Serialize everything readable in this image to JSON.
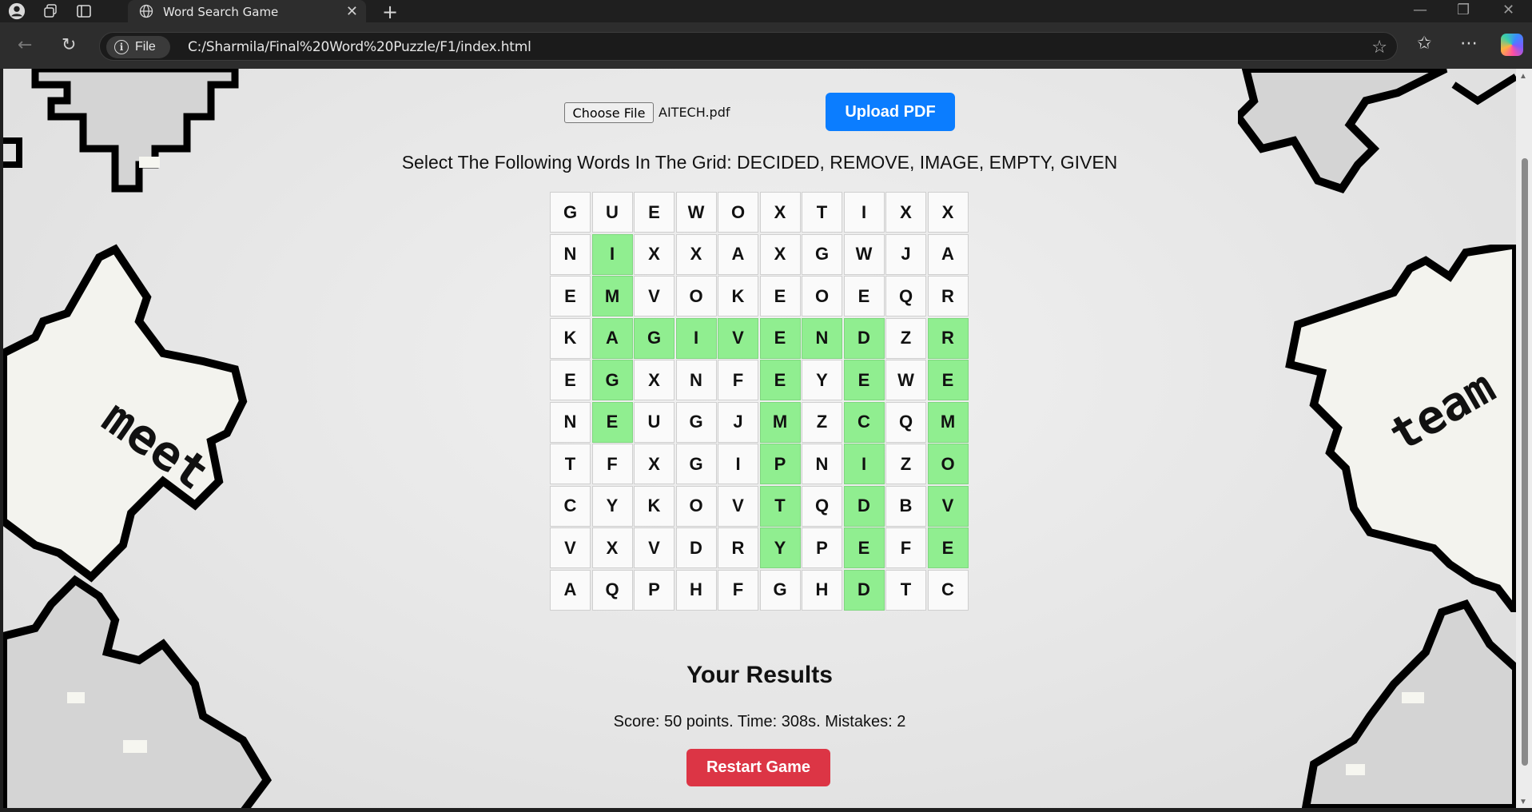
{
  "browser": {
    "tab_title": "Word Search Game",
    "scheme_label": "File",
    "url": "C:/Sharmila/Final%20Word%20Puzzle/F1/index.html"
  },
  "icons": {
    "profile": "profile-icon",
    "workspaces": "workspaces-icon",
    "tab_actions": "tab-actions-icon",
    "globe": "globe-icon",
    "close": "close-icon",
    "new_tab": "plus-icon",
    "back": "back-arrow-icon",
    "reload": "reload-icon",
    "info": "info-icon",
    "favorite": "star-icon",
    "favorites": "favorites-icon",
    "menu": "more-icon",
    "copilot": "copilot-icon"
  },
  "uploader": {
    "choose_label": "Choose File",
    "file_name": "AITECH.pdf",
    "upload_label": "Upload PDF"
  },
  "instruction": "Select The Following Words In The Grid: DECIDED, REMOVE, IMAGE, EMPTY, GIVEN",
  "grid": {
    "rows": [
      [
        "G",
        "U",
        "E",
        "W",
        "O",
        "X",
        "T",
        "I",
        "X",
        "X"
      ],
      [
        "N",
        "I",
        "X",
        "X",
        "A",
        "X",
        "G",
        "W",
        "J",
        "A"
      ],
      [
        "E",
        "M",
        "V",
        "O",
        "K",
        "E",
        "O",
        "E",
        "Q",
        "R"
      ],
      [
        "K",
        "A",
        "G",
        "I",
        "V",
        "E",
        "N",
        "D",
        "Z",
        "R"
      ],
      [
        "E",
        "G",
        "X",
        "N",
        "F",
        "E",
        "Y",
        "E",
        "W",
        "E"
      ],
      [
        "N",
        "E",
        "U",
        "G",
        "J",
        "M",
        "Z",
        "C",
        "Q",
        "M"
      ],
      [
        "T",
        "F",
        "X",
        "G",
        "I",
        "P",
        "N",
        "I",
        "Z",
        "O"
      ],
      [
        "C",
        "Y",
        "K",
        "O",
        "V",
        "T",
        "Q",
        "D",
        "B",
        "V"
      ],
      [
        "V",
        "X",
        "V",
        "D",
        "R",
        "Y",
        "P",
        "E",
        "F",
        "E"
      ],
      [
        "A",
        "Q",
        "P",
        "H",
        "F",
        "G",
        "H",
        "D",
        "T",
        "C"
      ]
    ],
    "found": [
      [
        1,
        1
      ],
      [
        2,
        1
      ],
      [
        3,
        1
      ],
      [
        4,
        1
      ],
      [
        5,
        1
      ],
      [
        3,
        2
      ],
      [
        3,
        3
      ],
      [
        3,
        4
      ],
      [
        3,
        5
      ],
      [
        3,
        6
      ],
      [
        3,
        7
      ],
      [
        4,
        7
      ],
      [
        5,
        7
      ],
      [
        6,
        7
      ],
      [
        7,
        7
      ],
      [
        8,
        7
      ],
      [
        9,
        7
      ],
      [
        3,
        9
      ],
      [
        4,
        9
      ],
      [
        5,
        9
      ],
      [
        6,
        9
      ],
      [
        7,
        9
      ],
      [
        8,
        9
      ],
      [
        4,
        5
      ],
      [
        5,
        5
      ],
      [
        6,
        5
      ],
      [
        7,
        5
      ],
      [
        8,
        5
      ]
    ]
  },
  "results": {
    "title": "Your Results",
    "summary": "Score: 50 points. Time: 308s. Mistakes: 2",
    "restart_label": "Restart Game"
  },
  "decorations": {
    "left_piece_text": "meet",
    "right_piece_text": "team"
  },
  "colors": {
    "found_cell": "#90ee90",
    "upload_button": "#0b7dff",
    "restart_button": "#dc3545"
  }
}
